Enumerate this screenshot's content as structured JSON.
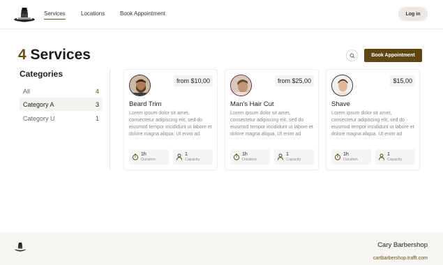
{
  "nav": {
    "items": [
      "Services",
      "Locations",
      "Book Appointment"
    ],
    "login_label": "Log in"
  },
  "page": {
    "count": "4",
    "title": "Services",
    "book_label": "Book Appointment"
  },
  "sidebar": {
    "title": "Categories",
    "items": [
      {
        "label": "All",
        "count": "4"
      },
      {
        "label": "Category A",
        "count": "3"
      },
      {
        "label": "Category U",
        "count": "1"
      }
    ]
  },
  "services": [
    {
      "name": "Beard Trim",
      "price": "from $10,00",
      "description": "Lorem ipsum dolor sit amet, consectetur adipiscing elit, sed do eiusmod tempor incididunt ut labore et dolore magna aliqua. Ut enim ad",
      "duration": "1h",
      "duration_label": "Duration",
      "capacity": "1",
      "capacity_label": "Capacity"
    },
    {
      "name": "Man's Hair Cut",
      "price": "from $25,00",
      "description": "Lorem ipsum dolor sit amet, consectetur adipiscing elit, sed do eiusmod tempor incididunt ut labore et dolore magna aliqua. Ut enim ad",
      "duration": "1h",
      "duration_label": "Duration",
      "capacity": "1",
      "capacity_label": "Capacity"
    },
    {
      "name": "Shave",
      "price": "$15,00",
      "description": "Lorem ipsum dolor sit amet, consectetur adipiscing elit, sed do eiusmod tempor incididunt ut labore et dolore magna aliqua. Ut enim ad",
      "duration": "1h",
      "duration_label": "Duration",
      "capacity": "1",
      "capacity_label": "Capacity"
    }
  ],
  "footer": {
    "name": "Cary Barbershop",
    "link": "cartbarbershop.trafft.com"
  },
  "colors": {
    "accent": "#5f4613",
    "accent_text": "#6b4f12"
  }
}
